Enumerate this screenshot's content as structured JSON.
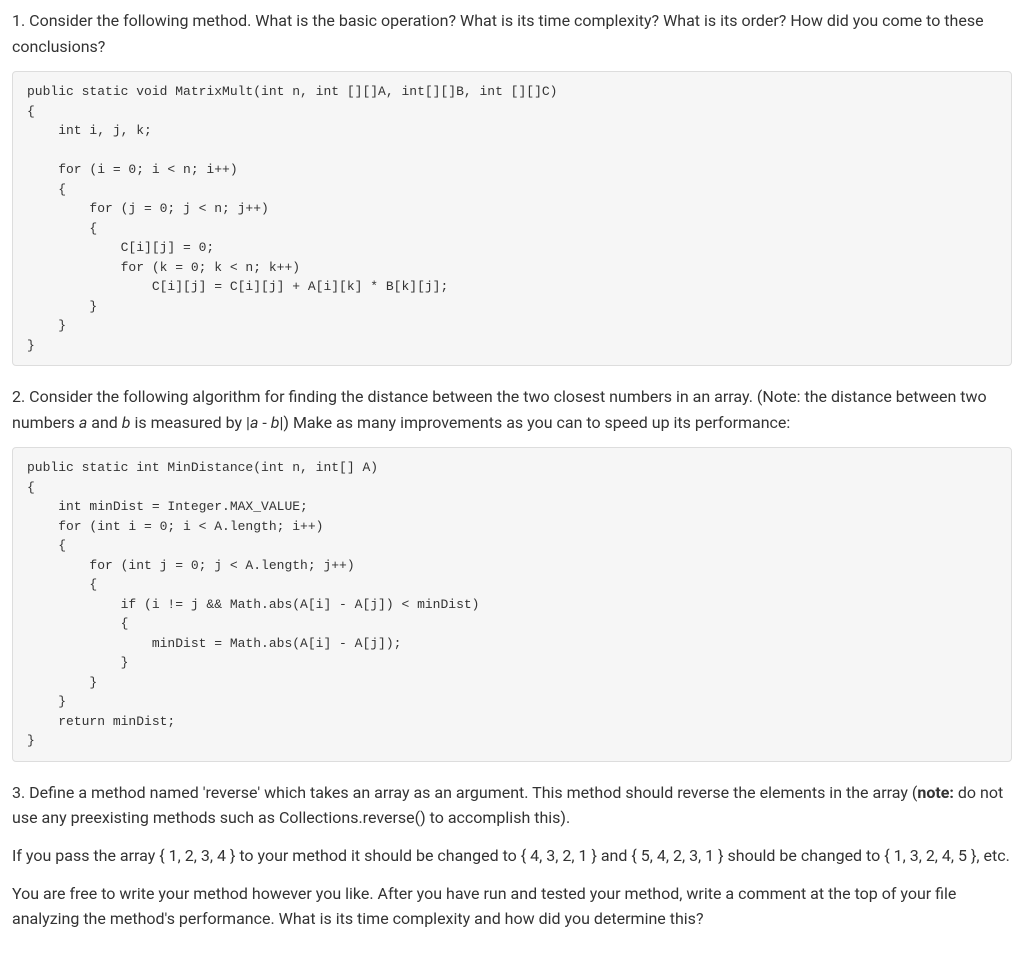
{
  "q1": {
    "text": "1. Consider the following method. What is the basic operation? What is its time complexity? What is its order? How did you come to these conclusions?",
    "code": "public static void MatrixMult(int n, int [][]A, int[][]B, int [][]C)\n{\n    int i, j, k;\n\n    for (i = 0; i < n; i++)\n    {\n        for (j = 0; j < n; j++)\n        {\n            C[i][j] = 0;\n            for (k = 0; k < n; k++)\n                C[i][j] = C[i][j] + A[i][k] * B[k][j];\n        }\n    }\n}"
  },
  "q2": {
    "text_part1": "2. Consider the following algorithm for finding the distance between the two closest numbers in an array. (Note: the distance between two numbers ",
    "italic_a": "a",
    "text_and": " and ",
    "italic_b": "b",
    "text_measured": " is measured by |",
    "italic_a2": "a",
    "text_dash": " - ",
    "italic_b2": "b",
    "text_part2": "|) Make as many improvements as you can to speed up its performance:",
    "code": "public static int MinDistance(int n, int[] A)\n{\n    int minDist = Integer.MAX_VALUE;\n    for (int i = 0; i < A.length; i++)\n    {\n        for (int j = 0; j < A.length; j++)\n        {\n            if (i != j && Math.abs(A[i] - A[j]) < minDist)\n            {\n                minDist = Math.abs(A[i] - A[j]);\n            }\n        }\n    }\n    return minDist;\n}"
  },
  "q3": {
    "p1_part1": "3. Define a method named 'reverse' which takes an array as an argument. This method should reverse the elements in the array (",
    "p1_bold": "note:",
    "p1_part2": " do not use any preexisting methods such as Collections.reverse() to accomplish this).",
    "p2": "If you pass the array { 1, 2, 3, 4 } to your method it should be changed to { 4, 3, 2, 1 } and { 5, 4, 2, 3, 1 } should be changed to { 1, 3, 2, 4, 5 }, etc.",
    "p3": "You are free to write your method however you like. After you have run and tested your method, write a comment at the top of your file analyzing the method's performance. What is its time complexity and how did you determine this?"
  }
}
